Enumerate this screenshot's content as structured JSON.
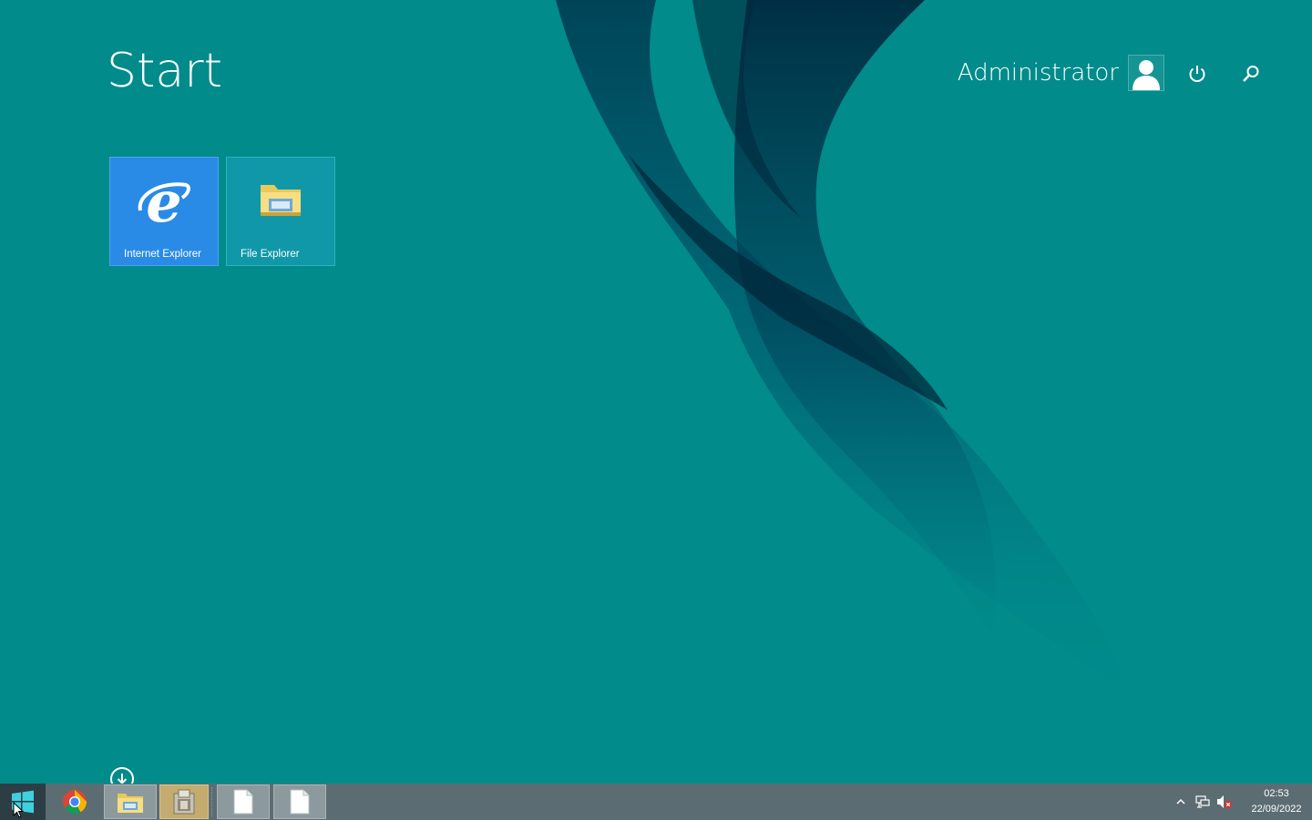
{
  "start_screen": {
    "title": "Start",
    "user_name": "Administrator"
  },
  "tiles": [
    {
      "label": "Internet Explorer",
      "icon": "internet-explorer-icon",
      "color": "#2a8be6"
    },
    {
      "label": "File Explorer",
      "icon": "file-explorer-icon",
      "color": "#1098a8"
    }
  ],
  "taskbar": {
    "items": [
      {
        "name": "start-button",
        "icon": "windows-logo-icon"
      },
      {
        "name": "chrome",
        "icon": "chrome-icon"
      },
      {
        "name": "file-explorer",
        "icon": "file-explorer-icon"
      },
      {
        "name": "app",
        "icon": "app-icon"
      },
      {
        "name": "document-1",
        "icon": "document-icon"
      },
      {
        "name": "document-2",
        "icon": "document-icon"
      }
    ],
    "clock": {
      "time": "02:53",
      "date": "22/09/2022"
    }
  },
  "colors": {
    "background": "#018b8b",
    "taskbar": "#5b6d72",
    "ie_tile": "#2a8be6",
    "fe_tile": "#1098a8"
  }
}
